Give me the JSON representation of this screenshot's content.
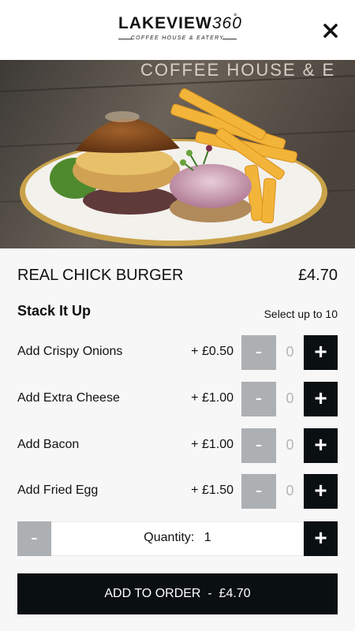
{
  "header": {
    "logo_main": "LAKEVIEW",
    "logo_num": "360",
    "logo_deg": "°",
    "logo_sub": "COFFEE HOUSE & EATERY"
  },
  "hero": {
    "sign_text": "COFFEE HOUSE & E"
  },
  "product": {
    "name": "REAL CHICK BURGER",
    "price": "£4.70"
  },
  "group": {
    "title": "Stack It Up",
    "note": "Select up to 10"
  },
  "options": [
    {
      "label": "Add Crispy Onions",
      "price": "+ £0.50",
      "count": "0"
    },
    {
      "label": "Add Extra Cheese",
      "price": "+ £1.00",
      "count": "0"
    },
    {
      "label": "Add Bacon",
      "price": "+ £1.00",
      "count": "0"
    },
    {
      "label": "Add Fried Egg",
      "price": "+ £1.50",
      "count": "0"
    }
  ],
  "controls": {
    "minus": "-",
    "plus": "+"
  },
  "quantity": {
    "label": "Quantity:",
    "value": "1"
  },
  "order_button": {
    "label": "ADD TO ORDER",
    "separator": "-",
    "total": "£4.70"
  },
  "colors": {
    "dark": "#0a0f12",
    "disabled": "#adb0b3",
    "background": "#f7f7f7"
  }
}
